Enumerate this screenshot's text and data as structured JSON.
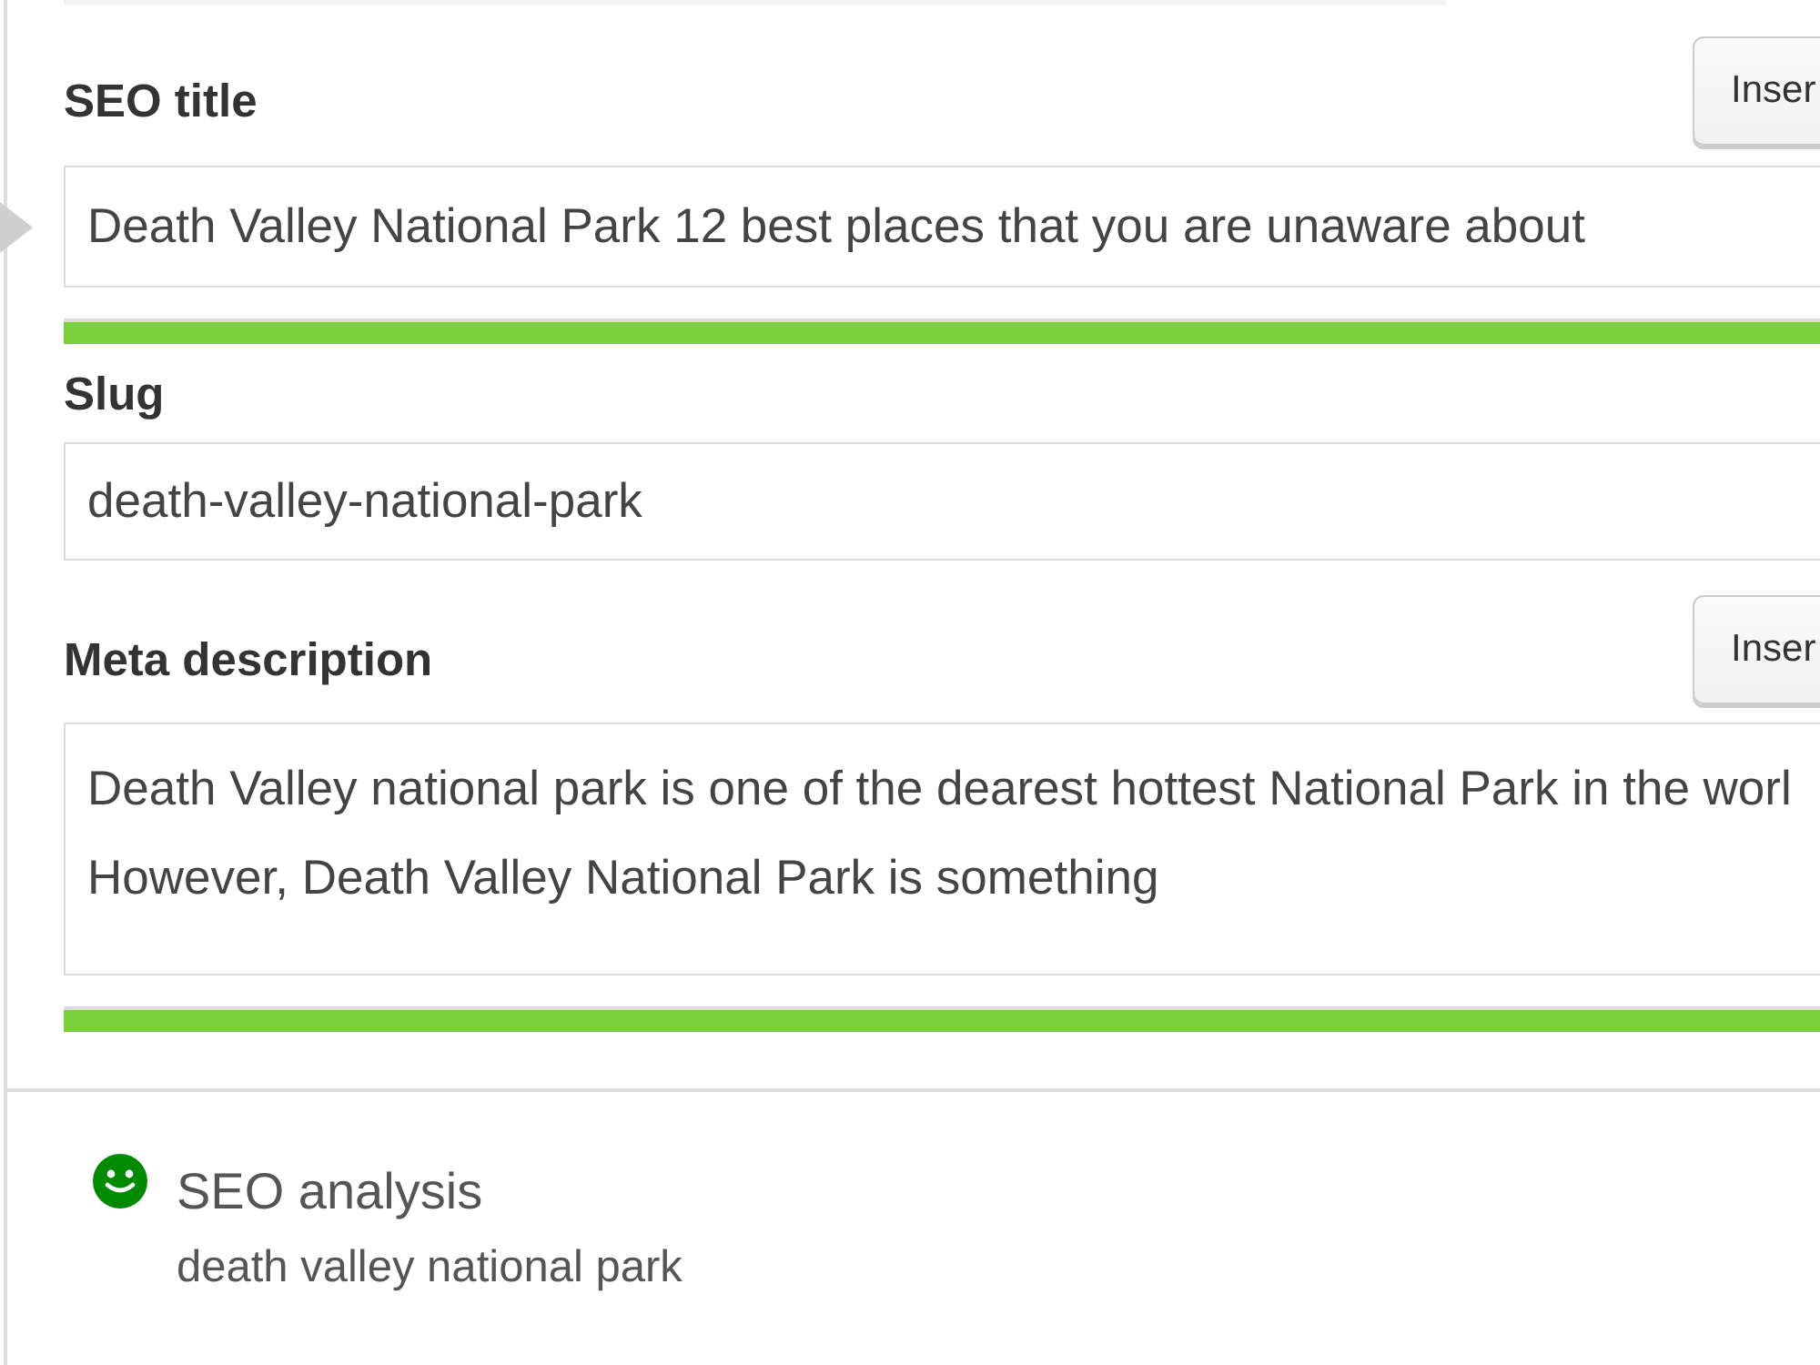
{
  "fields": [
    {
      "kind": "line",
      "label": "SEO title",
      "insert_button": "Inser",
      "value": "Death Valley National Park 12 best places that you are unaware about",
      "progress": {
        "level": 1
      }
    },
    {
      "kind": "line",
      "label": "Slug",
      "value": "death-valley-national-park"
    },
    {
      "kind": "text",
      "label": "Meta description",
      "insert_button": "Inser",
      "value": "Death Valley national park is one of the dearest hottest National Park in the worl\nHowever, Death Valley National Park is something",
      "progress": {
        "level": 1
      }
    }
  ],
  "seo_analysis": {
    "title": "SEO analysis",
    "keyphrase": "death valley national park"
  }
}
